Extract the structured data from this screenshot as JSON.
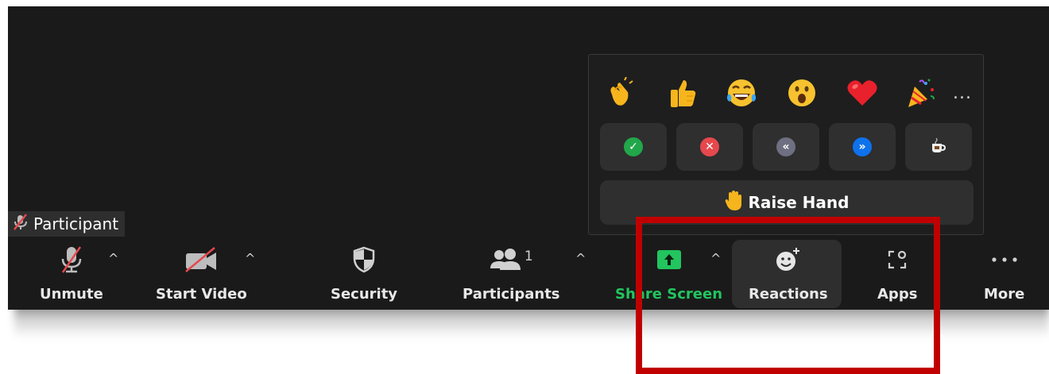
{
  "participant_tag": {
    "name": "Participant",
    "icon": "muted-mic-icon"
  },
  "reactions_popup": {
    "emojis": [
      {
        "name": "clapping-hands",
        "glyph": "👏"
      },
      {
        "name": "thumbs-up",
        "glyph": "👍"
      },
      {
        "name": "tears-of-joy",
        "glyph": "😂"
      },
      {
        "name": "open-mouth",
        "glyph": "😮"
      },
      {
        "name": "red-heart",
        "glyph": "❤️"
      },
      {
        "name": "party-popper",
        "glyph": "🎉"
      }
    ],
    "more_emojis": "...",
    "feedback": [
      {
        "name": "yes",
        "glyph": "✓",
        "color": "#22a74a"
      },
      {
        "name": "no",
        "glyph": "✕",
        "color": "#e5484d"
      },
      {
        "name": "slow-down",
        "glyph": "«",
        "color": "#6f6f82"
      },
      {
        "name": "speed-up",
        "glyph": "»",
        "color": "#0e72ed"
      },
      {
        "name": "coffee",
        "glyph": "☕",
        "color": "#2f2f2f"
      }
    ],
    "raise_hand": {
      "label": "Raise Hand",
      "glyph": "✋"
    }
  },
  "toolbar": {
    "unmute": "Unmute",
    "start_video": "Start Video",
    "security": "Security",
    "participants": "Participants",
    "participants_count": "1",
    "share_screen": "Share Screen",
    "reactions": "Reactions",
    "apps": "Apps",
    "more": "More",
    "share_color": "#22c55e",
    "caret": "^"
  },
  "highlight_color": "#c00000"
}
